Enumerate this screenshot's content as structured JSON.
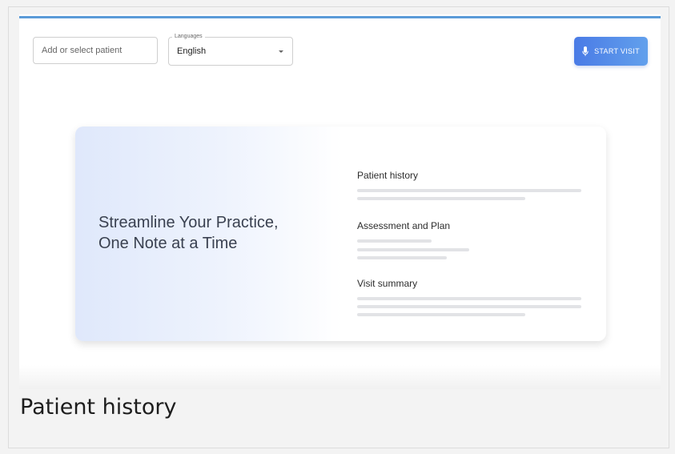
{
  "toolbar": {
    "patient_placeholder": "Add or select patient",
    "language_legend": "Languages",
    "language_value": "English",
    "start_label": "START VISIT"
  },
  "hero": {
    "title_line1": "Streamline Your Practice,",
    "title_line2": "One Note at a Time",
    "sections": [
      {
        "label": "Patient history"
      },
      {
        "label": "Assessment and Plan"
      },
      {
        "label": "Visit summary"
      }
    ]
  },
  "caption": "Patient history",
  "colors": {
    "accent": "#4a7be6",
    "accent_light": "#62a0ec",
    "top_line": "#5b9bd8",
    "placeholder_bar": "#e2e3e6"
  },
  "icons": {
    "start_button_icon": "microphone-icon",
    "language_dropdown_icon": "caret-down-icon"
  }
}
